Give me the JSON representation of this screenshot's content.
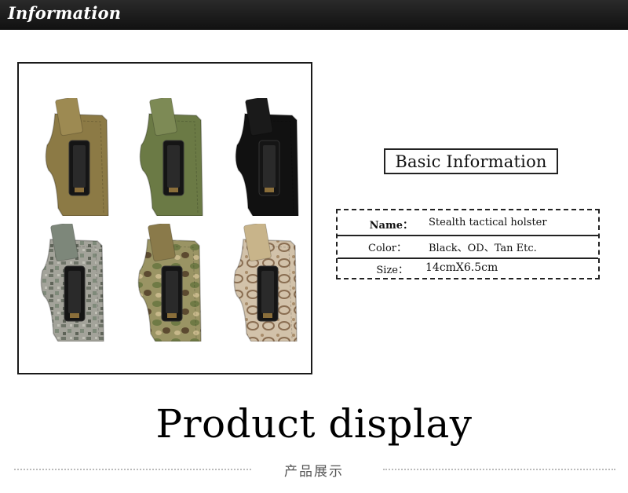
{
  "header": {
    "title": "Information"
  },
  "photo": {
    "items": [
      {
        "name": "holster-tan",
        "color": "#8c7a45",
        "flap": "#9d8a52",
        "pattern": "solid"
      },
      {
        "name": "holster-od",
        "color": "#6b7a45",
        "flap": "#7d8a55",
        "pattern": "solid"
      },
      {
        "name": "holster-black",
        "color": "#111111",
        "flap": "#1a1a1a",
        "pattern": "solid"
      },
      {
        "name": "holster-digital-camo",
        "color": "#9a9a92",
        "flap": "#7d877a",
        "pattern": "digital"
      },
      {
        "name": "holster-multicam",
        "color": "#8d8a5a",
        "flap": "#8a7a4a",
        "pattern": "multicam"
      },
      {
        "name": "holster-python-camo",
        "color": "#c9b8a0",
        "flap": "#c8b48a",
        "pattern": "python"
      }
    ]
  },
  "info": {
    "heading": "Basic Information",
    "rows": [
      {
        "label": "Name：",
        "value": "Stealth tactical holster"
      },
      {
        "label": "Color：",
        "value": "Black、OD、Tan   Etc."
      },
      {
        "label": "Size：",
        "value": "14cmX6.5cm"
      }
    ]
  },
  "display": {
    "title": "Product display",
    "subtitle": "产品展示"
  }
}
